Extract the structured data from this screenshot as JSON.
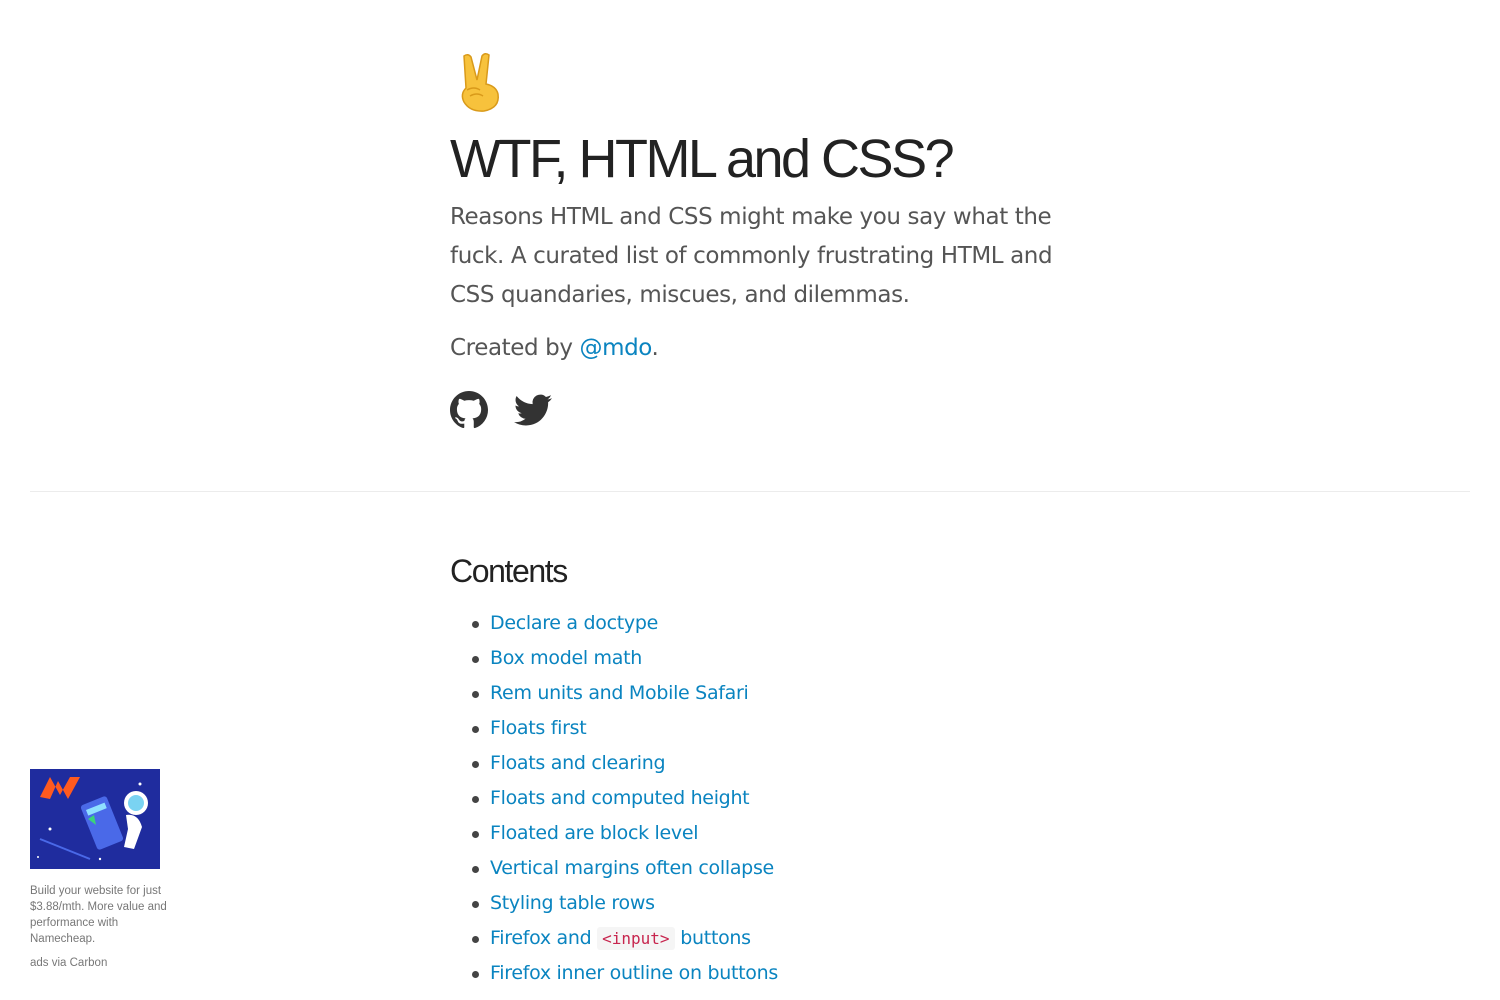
{
  "header": {
    "emoji": "victory-hand",
    "title": "WTF, HTML and CSS?",
    "lead": "Reasons HTML and CSS might make you say what the fuck. A curated list of commonly frustrating HTML and CSS quandaries, miscues, and dilemmas.",
    "byline_prefix": "Created by ",
    "byline_link": "@mdo",
    "byline_suffix": ".",
    "social_icons": [
      "github-icon",
      "twitter-icon"
    ]
  },
  "contents": {
    "heading": "Contents",
    "items": [
      {
        "label": "Declare a doctype"
      },
      {
        "label": "Box model math"
      },
      {
        "label": "Rem units and Mobile Safari"
      },
      {
        "label": "Floats first"
      },
      {
        "label": "Floats and clearing"
      },
      {
        "label": "Floats and computed height"
      },
      {
        "label": "Floated are block level"
      },
      {
        "label": "Vertical margins often collapse"
      },
      {
        "label": "Styling table rows"
      },
      {
        "label_before": "Firefox and ",
        "code": "<input>",
        "label_after": " buttons"
      },
      {
        "label": "Firefox inner outline on buttons"
      }
    ]
  },
  "ad": {
    "text": "Build your website for just $3.88/mth. More value and performance with Namecheap.",
    "via": "ads via Carbon",
    "image_icon": "namecheap-ad-image"
  },
  "colors": {
    "link": "#0a84c0",
    "text": "#555555",
    "heading": "#222222",
    "code": "#c7254e"
  }
}
